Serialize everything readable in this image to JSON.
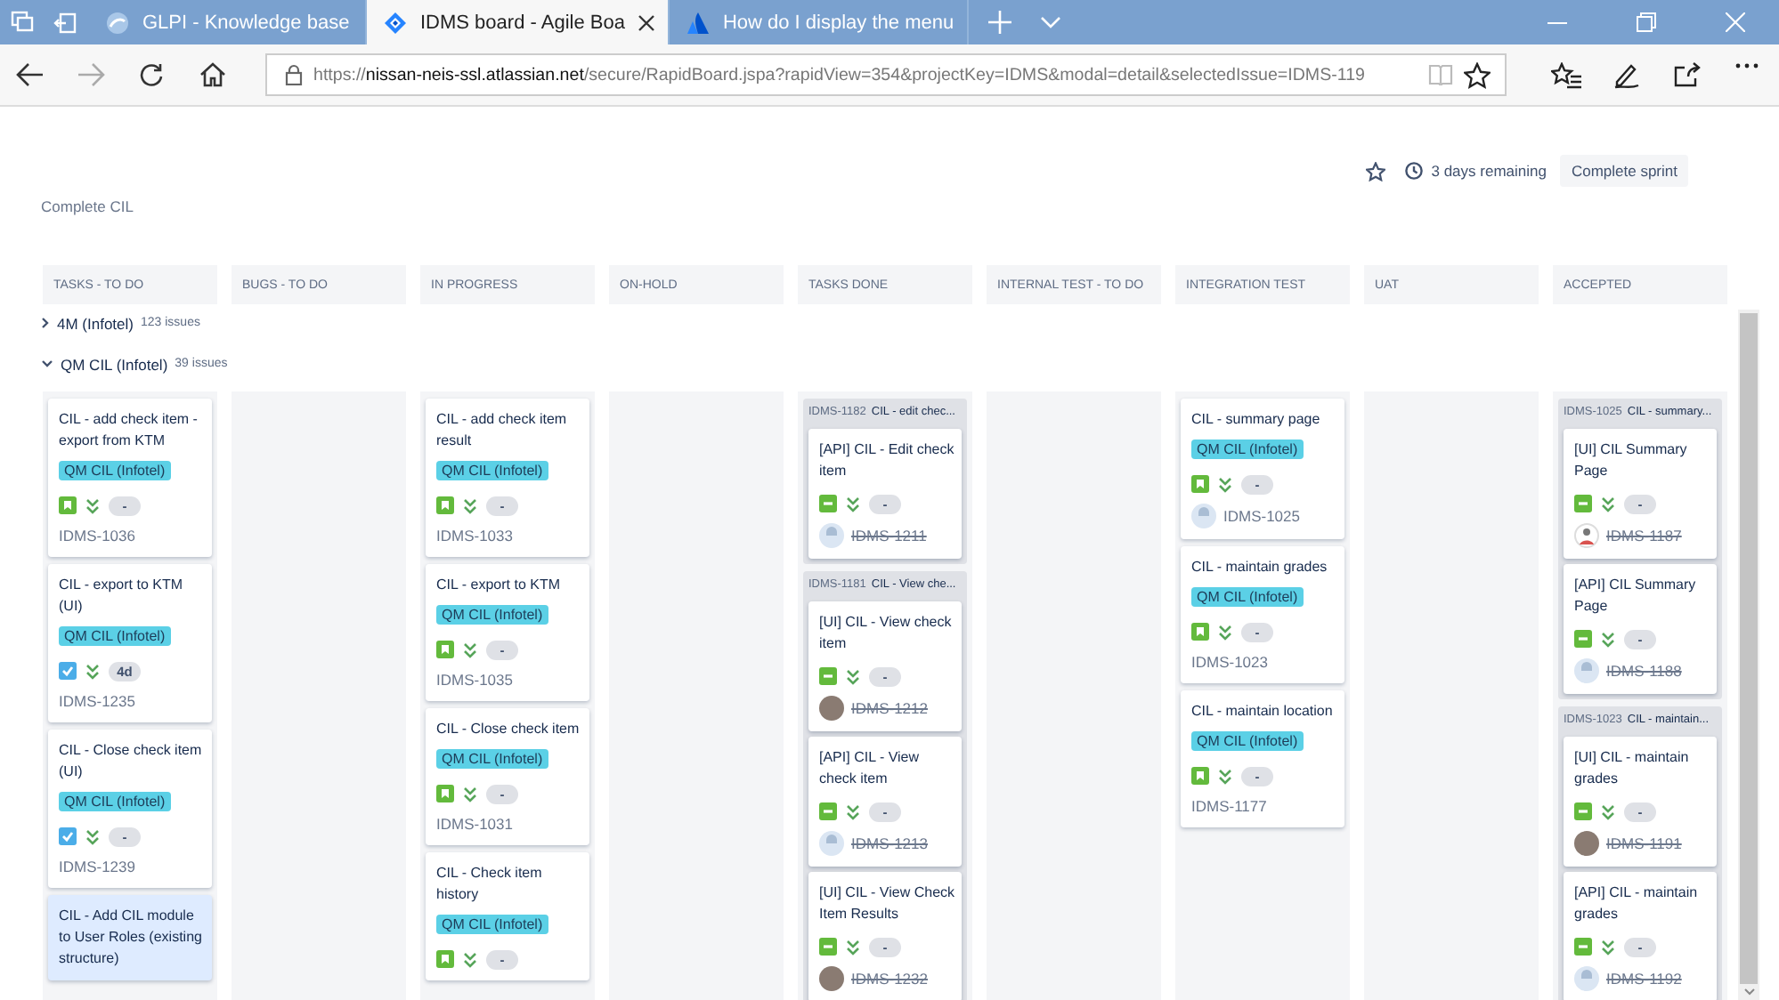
{
  "browser": {
    "tabs": [
      {
        "title": "GLPI - Knowledge base",
        "selected": false
      },
      {
        "title": "IDMS board - Agile Boa",
        "selected": true
      },
      {
        "title": "How do I display the menu",
        "selected": false
      }
    ],
    "address": {
      "scheme": "https://",
      "host": "nissan-neis-ssl.atlassian.net",
      "path": "/secure/RapidBoard.jspa?rapidView=354&projectKey=IDMS&modal=detail&selectedIssue=IDMS-119"
    }
  },
  "board": {
    "remaining": "3 days remaining",
    "complete_button": "Complete sprint",
    "sprint_goal": "Complete CIL",
    "columns": [
      "TASKS - TO DO",
      "BUGS - TO DO",
      "IN PROGRESS",
      "ON-HOLD",
      "TASKS DONE",
      "INTERNAL TEST - TO DO",
      "INTEGRATION TEST",
      "UAT",
      "ACCEPTED"
    ],
    "swimlanes": [
      {
        "name": "4M (Infotel)",
        "count": "123 issues",
        "expanded": false
      },
      {
        "name": "QM CIL (Infotel)",
        "count": "39 issues",
        "expanded": true,
        "columns": [
          {
            "items": [
              {
                "kind": "story",
                "summary": "CIL - add check item - export from KTM",
                "epic": "QM CIL (Infotel)",
                "estimate": "-",
                "key": "IDMS-1036",
                "done": false,
                "selected": false
              },
              {
                "kind": "task",
                "summary": "CIL - export to KTM (UI)",
                "epic": "QM CIL (Infotel)",
                "estimate": "4d",
                "key": "IDMS-1235",
                "done": false,
                "selected": false
              },
              {
                "kind": "task",
                "summary": "CIL - Close check item (UI)",
                "epic": "QM CIL (Infotel)",
                "estimate": "-",
                "key": "IDMS-1239",
                "done": false,
                "selected": false
              },
              {
                "kind": "story",
                "summary": "CIL - Add CIL module to User Roles (existing structure)",
                "selected": true
              }
            ]
          },
          {},
          {
            "items": [
              {
                "kind": "story",
                "summary": "CIL - add check item result",
                "epic": "QM CIL (Infotel)",
                "estimate": "-",
                "key": "IDMS-1033",
                "done": false,
                "selected": false
              },
              {
                "kind": "story",
                "summary": "CIL - export to KTM",
                "epic": "QM CIL (Infotel)",
                "estimate": "-",
                "key": "IDMS-1035",
                "done": false,
                "selected": false
              },
              {
                "kind": "story",
                "summary": "CIL - Close check item",
                "epic": "QM CIL (Infotel)",
                "estimate": "-",
                "key": "IDMS-1031",
                "done": false,
                "selected": false
              },
              {
                "kind": "story",
                "summary": "CIL - Check item history",
                "epic": "QM CIL (Infotel)",
                "estimate": "-",
                "selected": false
              }
            ]
          },
          {},
          {
            "items": [
              {
                "kind": "parent",
                "key": "IDMS-1182",
                "summary": "CIL - edit chec...",
                "children": [
                  {
                    "kind": "subtask",
                    "summary": "[API] CIL - Edit check item",
                    "estimate": "-",
                    "avatar": {
                      "kind": "default"
                    },
                    "key": "IDMS-1211",
                    "done": true,
                    "selected": false
                  }
                ]
              },
              {
                "kind": "parent",
                "key": "IDMS-1181",
                "summary": "CIL - View che...",
                "children": [
                  {
                    "kind": "subtask",
                    "summary": "[UI] CIL - View check item",
                    "estimate": "-",
                    "avatar": {
                      "kind": "photo"
                    },
                    "key": "IDMS-1212",
                    "done": true,
                    "selected": false
                  },
                  {
                    "kind": "subtask",
                    "summary": "[API] CIL - View check item",
                    "estimate": "-",
                    "avatar": {
                      "kind": "default"
                    },
                    "key": "IDMS-1213",
                    "done": true,
                    "selected": false
                  },
                  {
                    "kind": "subtask",
                    "summary": "[UI] CIL - View Check Item Results",
                    "estimate": "-",
                    "avatar": {
                      "kind": "photo"
                    },
                    "key": "IDMS-1232",
                    "done": true,
                    "selected": false
                  }
                ]
              }
            ]
          },
          {},
          {
            "items": [
              {
                "kind": "story",
                "summary": "CIL - summary page",
                "epic": "QM CIL (Infotel)",
                "estimate": "-",
                "avatar": {
                  "kind": "default"
                },
                "key": "IDMS-1025",
                "done": false,
                "selected": false
              },
              {
                "kind": "story",
                "summary": "CIL - maintain grades",
                "epic": "QM CIL (Infotel)",
                "estimate": "-",
                "key": "IDMS-1023",
                "done": false,
                "selected": false
              },
              {
                "kind": "story",
                "summary": "CIL - maintain location",
                "epic": "QM CIL (Infotel)",
                "estimate": "-",
                "key": "IDMS-1177",
                "done": false,
                "selected": false
              }
            ]
          },
          {},
          {
            "items": [
              {
                "kind": "parent",
                "key": "IDMS-1025",
                "summary": "CIL - summary...",
                "children": [
                  {
                    "kind": "subtask",
                    "summary": "[UI] CIL Summary Page",
                    "estimate": "-",
                    "avatar": {
                      "kind": "figure"
                    },
                    "key": "IDMS-1187",
                    "done": true,
                    "selected": false
                  },
                  {
                    "kind": "subtask",
                    "summary": "[API] CIL Summary Page",
                    "estimate": "-",
                    "avatar": {
                      "kind": "default"
                    },
                    "key": "IDMS-1188",
                    "done": true,
                    "selected": false
                  }
                ]
              },
              {
                "kind": "parent",
                "key": "IDMS-1023",
                "summary": "CIL - maintain...",
                "children": [
                  {
                    "kind": "subtask",
                    "summary": "[UI] CIL - maintain grades",
                    "estimate": "-",
                    "avatar": {
                      "kind": "photo"
                    },
                    "key": "IDMS-1191",
                    "done": true,
                    "selected": false
                  },
                  {
                    "kind": "subtask",
                    "summary": "[API] CIL - maintain grades",
                    "estimate": "-",
                    "avatar": {
                      "kind": "default"
                    },
                    "key": "IDMS-1192",
                    "done": true,
                    "selected": false
                  }
                ]
              }
            ]
          }
        ]
      }
    ]
  }
}
